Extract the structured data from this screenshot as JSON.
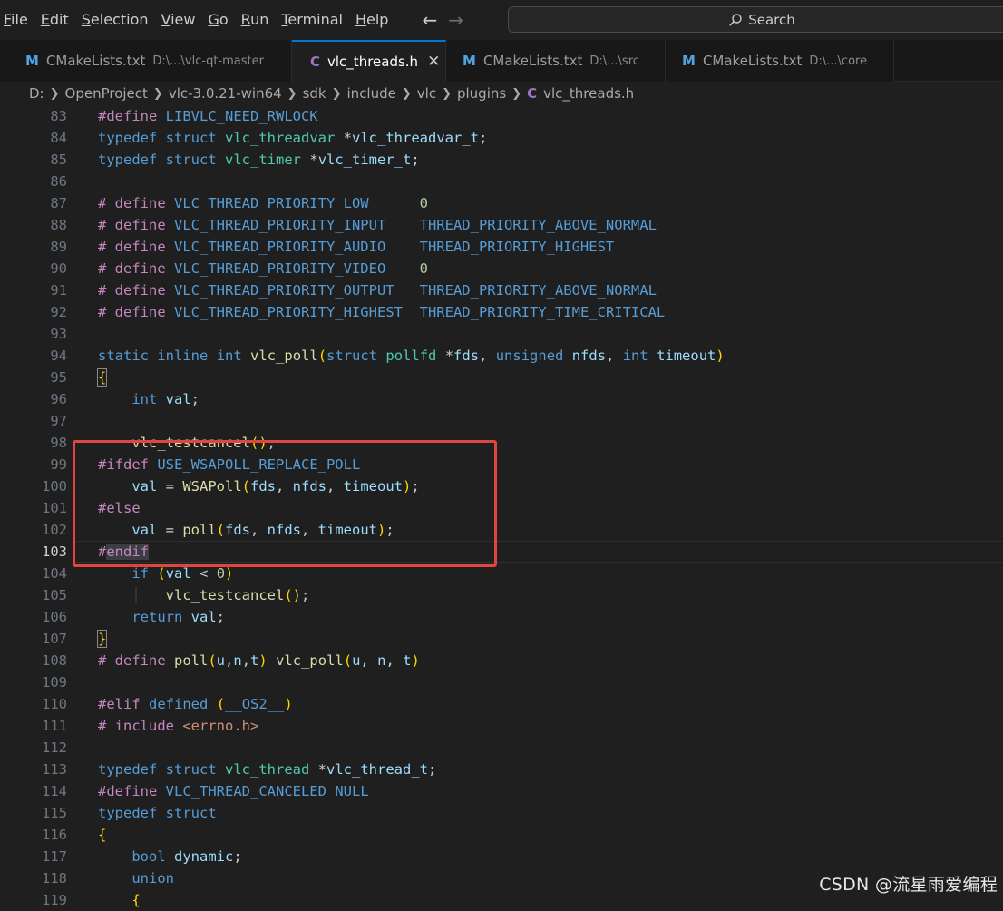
{
  "menubar": {
    "items": [
      "File",
      "Edit",
      "Selection",
      "View",
      "Go",
      "Run",
      "Terminal",
      "Help"
    ],
    "underline_first_letters": [
      "F",
      "E",
      "S",
      "V",
      "G",
      "R",
      "T",
      "H"
    ],
    "search_label": "Search"
  },
  "tabs": [
    {
      "icon": "M",
      "name": "CMakeLists.txt",
      "path": "D:\\...\\vlc-qt-master",
      "active": false
    },
    {
      "icon": "C",
      "name": "vlc_threads.h",
      "path": "",
      "active": true
    },
    {
      "icon": "M",
      "name": "CMakeLists.txt",
      "path": "D:\\...\\src",
      "active": false
    },
    {
      "icon": "M",
      "name": "CMakeLists.txt",
      "path": "D:\\...\\core",
      "active": false
    }
  ],
  "breadcrumb": [
    "D:",
    "OpenProject",
    "vlc-3.0.21-win64",
    "sdk",
    "include",
    "vlc",
    "plugins"
  ],
  "breadcrumb_file": {
    "icon": "C",
    "name": "vlc_threads.h"
  },
  "editor": {
    "current_line": 103,
    "lines": [
      {
        "n": "83",
        "t": "#define LIBVLC_NEED_RWLOCK"
      },
      {
        "n": "84",
        "t": "typedef struct vlc_threadvar *vlc_threadvar_t;"
      },
      {
        "n": "85",
        "t": "typedef struct vlc_timer *vlc_timer_t;"
      },
      {
        "n": "86",
        "t": ""
      },
      {
        "n": "87",
        "t": "# define VLC_THREAD_PRIORITY_LOW      0"
      },
      {
        "n": "88",
        "t": "# define VLC_THREAD_PRIORITY_INPUT    THREAD_PRIORITY_ABOVE_NORMAL"
      },
      {
        "n": "89",
        "t": "# define VLC_THREAD_PRIORITY_AUDIO    THREAD_PRIORITY_HIGHEST"
      },
      {
        "n": "90",
        "t": "# define VLC_THREAD_PRIORITY_VIDEO    0"
      },
      {
        "n": "91",
        "t": "# define VLC_THREAD_PRIORITY_OUTPUT   THREAD_PRIORITY_ABOVE_NORMAL"
      },
      {
        "n": "92",
        "t": "# define VLC_THREAD_PRIORITY_HIGHEST  THREAD_PRIORITY_TIME_CRITICAL"
      },
      {
        "n": "93",
        "t": ""
      },
      {
        "n": "94",
        "t": "static inline int vlc_poll(struct pollfd *fds, unsigned nfds, int timeout)"
      },
      {
        "n": "95",
        "t": "{"
      },
      {
        "n": "96",
        "t": "    int val;"
      },
      {
        "n": "97",
        "t": ""
      },
      {
        "n": "98",
        "t": "    vlc_testcancel();"
      },
      {
        "n": "99",
        "t": "#ifdef USE_WSAPOLL_REPLACE_POLL"
      },
      {
        "n": "100",
        "t": "    val = WSAPoll(fds, nfds, timeout);"
      },
      {
        "n": "101",
        "t": "#else"
      },
      {
        "n": "102",
        "t": "    val = poll(fds, nfds, timeout);"
      },
      {
        "n": "103",
        "t": "#endif"
      },
      {
        "n": "104",
        "t": "    if (val < 0)"
      },
      {
        "n": "105",
        "t": "    ǀ   vlc_testcancel();"
      },
      {
        "n": "106",
        "t": "    return val;"
      },
      {
        "n": "107",
        "t": "}"
      },
      {
        "n": "108",
        "t": "# define poll(u,n,t) vlc_poll(u, n, t)"
      },
      {
        "n": "109",
        "t": ""
      },
      {
        "n": "110",
        "t": "#elif defined (__OS2__)"
      },
      {
        "n": "111",
        "t": "# include <errno.h>"
      },
      {
        "n": "112",
        "t": ""
      },
      {
        "n": "113",
        "t": "typedef struct vlc_thread *vlc_thread_t;"
      },
      {
        "n": "114",
        "t": "#define VLC_THREAD_CANCELED NULL"
      },
      {
        "n": "115",
        "t": "typedef struct"
      },
      {
        "n": "116",
        "t": "{"
      },
      {
        "n": "117",
        "t": "    bool dynamic;"
      },
      {
        "n": "118",
        "t": "    union"
      },
      {
        "n": "119",
        "t": "    {"
      }
    ]
  },
  "watermark": "CSDN @流星雨爱编程",
  "colors": {
    "highlight_box": "#e0453f",
    "accent": "#0078d4"
  }
}
